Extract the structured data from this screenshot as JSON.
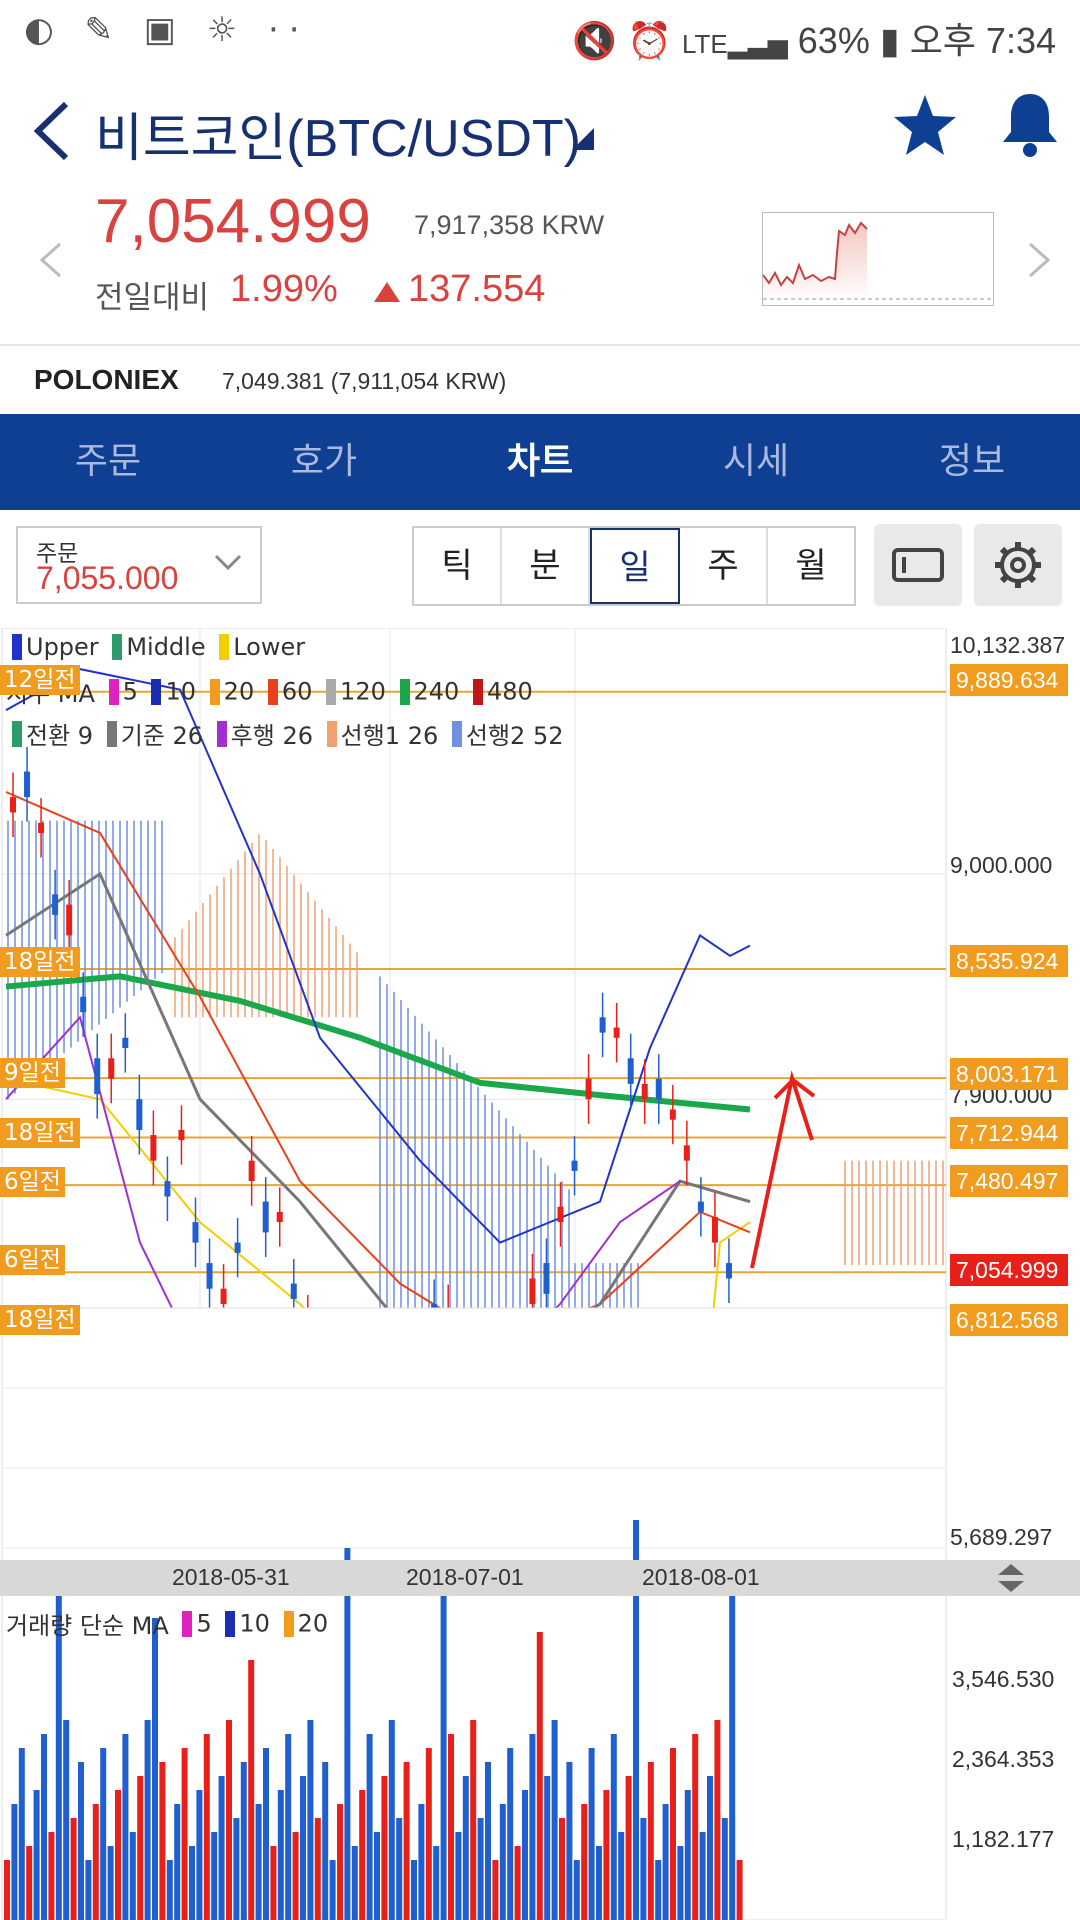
{
  "status_bar": {
    "left_icons": "◐ ✎ ▣ ☼ ··",
    "battery": "63%",
    "time": "오후 7:34"
  },
  "header": {
    "title": "비트코인(BTC/USDT)"
  },
  "price": {
    "main": "7,054.999",
    "krw": "7,917,358 KRW",
    "prev_label": "전일대비",
    "percent": "1.99%",
    "change": "137.554"
  },
  "exchange": {
    "name": "POLONIEX",
    "price": "7,049.381 (7,911,054 KRW)"
  },
  "tabs": [
    {
      "label": "주문"
    },
    {
      "label": "호가"
    },
    {
      "label": "차트"
    },
    {
      "label": "시세"
    },
    {
      "label": "정보"
    }
  ],
  "active_tab": "차트",
  "order": {
    "label": "주문",
    "value": "7,055.000"
  },
  "periods": [
    {
      "label": "틱"
    },
    {
      "label": "분"
    },
    {
      "label": "일"
    },
    {
      "label": "주"
    },
    {
      "label": "월"
    }
  ],
  "selected_period": "일",
  "legend": {
    "bollinger": [
      {
        "name": "Upper",
        "color": "#2233cc"
      },
      {
        "name": "Middle",
        "color": "#2e9c6a"
      },
      {
        "name": "Lower",
        "color": "#f2d000"
      }
    ],
    "ma_label": "지수 MA",
    "ma": [
      {
        "name": "5",
        "color": "#e020c0"
      },
      {
        "name": "10",
        "color": "#1a2db0"
      },
      {
        "name": "20",
        "color": "#f19c1f"
      },
      {
        "name": "60",
        "color": "#e8401a"
      },
      {
        "name": "120",
        "color": "#aaaaaa"
      },
      {
        "name": "240",
        "color": "#1aa84a"
      },
      {
        "name": "480",
        "color": "#c01818"
      }
    ],
    "ichimoku": [
      {
        "name": "전환 9",
        "color": "#2e9c6a"
      },
      {
        "name": "기준 26",
        "color": "#777777"
      },
      {
        "name": "후행 26",
        "color": "#a030d0"
      },
      {
        "name": "선행1 26",
        "color": "#f2a070"
      },
      {
        "name": "선행2 52",
        "color": "#7090e0"
      }
    ],
    "volume_label": "거래량 단순 MA",
    "volume_ma": [
      {
        "name": "5",
        "color": "#e020c0"
      },
      {
        "name": "10",
        "color": "#1a2db0"
      },
      {
        "name": "20",
        "color": "#f19c1f"
      }
    ]
  },
  "price_axis": {
    "top": "10,132.387",
    "mid": "9,000.000",
    "mid2": "7,900.000",
    "bottom": "5,689.297"
  },
  "price_tags": [
    {
      "value": "9,889.634",
      "color": "#f19c1f"
    },
    {
      "value": "8,535.924",
      "color": "#f19c1f"
    },
    {
      "value": "8,003.171",
      "color": "#f19c1f"
    },
    {
      "value": "7,712.944",
      "color": "#f19c1f"
    },
    {
      "value": "7,480.497",
      "color": "#f19c1f"
    },
    {
      "value": "7,054.999",
      "color": "#e8201a"
    },
    {
      "value": "6,812.568",
      "color": "#f19c1f"
    }
  ],
  "left_tags": [
    "12일전",
    "18일전",
    "9일전",
    "18일전",
    "6일전",
    "6일전",
    "18일전"
  ],
  "dates": [
    "2018-05-31",
    "2018-07-01",
    "2018-08-01"
  ],
  "volume_axis": [
    "3,546.530",
    "2,364.353",
    "1,182.177"
  ],
  "chart_data": {
    "type": "candlestick",
    "title": "",
    "x_range": [
      "2018-05-03",
      "2018-08-09"
    ],
    "y_range": [
      5689.297,
      10132.387
    ],
    "last_price": 7054.999,
    "price_levels": [
      9889.634,
      8535.924,
      8003.171,
      7712.944,
      7480.497,
      7054.999,
      6812.568
    ],
    "volume_axis_ticks": [
      1182.177,
      2364.353,
      3546.53
    ]
  }
}
